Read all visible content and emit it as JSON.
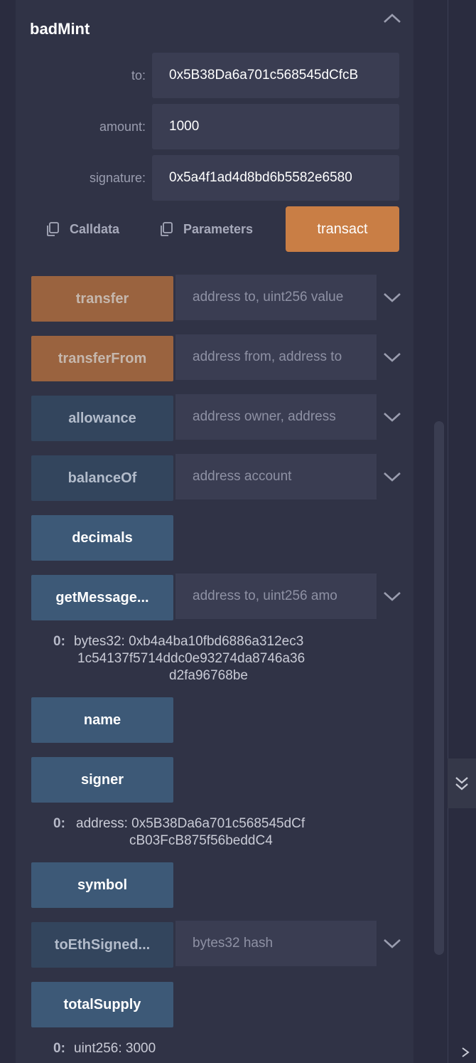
{
  "form": {
    "title": "badMint",
    "fields": [
      {
        "label": "to:",
        "value": "0x5B38Da6a701c568545dCfcB"
      },
      {
        "label": "amount:",
        "value": "1000"
      },
      {
        "label": "signature:",
        "value": "0x5a4f1ad4d8bd6b5582e6580"
      }
    ],
    "calldata_label": "Calldata",
    "parameters_label": "Parameters",
    "transact_label": "transact"
  },
  "functions": [
    {
      "name": "transfer",
      "placeholder": "address to, uint256 value"
    },
    {
      "name": "transferFrom",
      "placeholder": "address from, address to"
    },
    {
      "name": "allowance",
      "placeholder": "address owner, address"
    },
    {
      "name": "balanceOf",
      "placeholder": "address account"
    },
    {
      "name": "decimals"
    },
    {
      "name": "getMessage...",
      "placeholder": "address to, uint256 amo"
    },
    {
      "name": "name"
    },
    {
      "name": "signer"
    },
    {
      "name": "symbol"
    },
    {
      "name": "toEthSigned...",
      "placeholder": "bytes32 hash"
    },
    {
      "name": "totalSupply"
    }
  ],
  "outputs": {
    "getMessage": {
      "index": "0:",
      "lines": [
        "bytes32: 0xb4a4ba10fbd6886a312ec3",
        "1c54137f5714ddc0e93274da8746a36",
        "d2fa96768be"
      ]
    },
    "signer": {
      "index": "0:",
      "lines": [
        "address: 0x5B38Da6a701c568545dCf",
        "cB03FcB875f56beddC4"
      ]
    },
    "totalSupply": {
      "index": "0:",
      "lines": [
        "uint256: 3000"
      ]
    }
  },
  "icons": {
    "collapse": "chevron-up-icon",
    "expand": "chevron-down-icon",
    "copy": "copy-icon",
    "panel_toggle": "double-chevron-down-icon",
    "terminal": "caret-right-icon"
  },
  "colors": {
    "background": "#2a2c3f",
    "panel": "#303346",
    "transact": "#c97e45",
    "payable_fn": "#9a633f",
    "call_fn": "#3d5977"
  }
}
